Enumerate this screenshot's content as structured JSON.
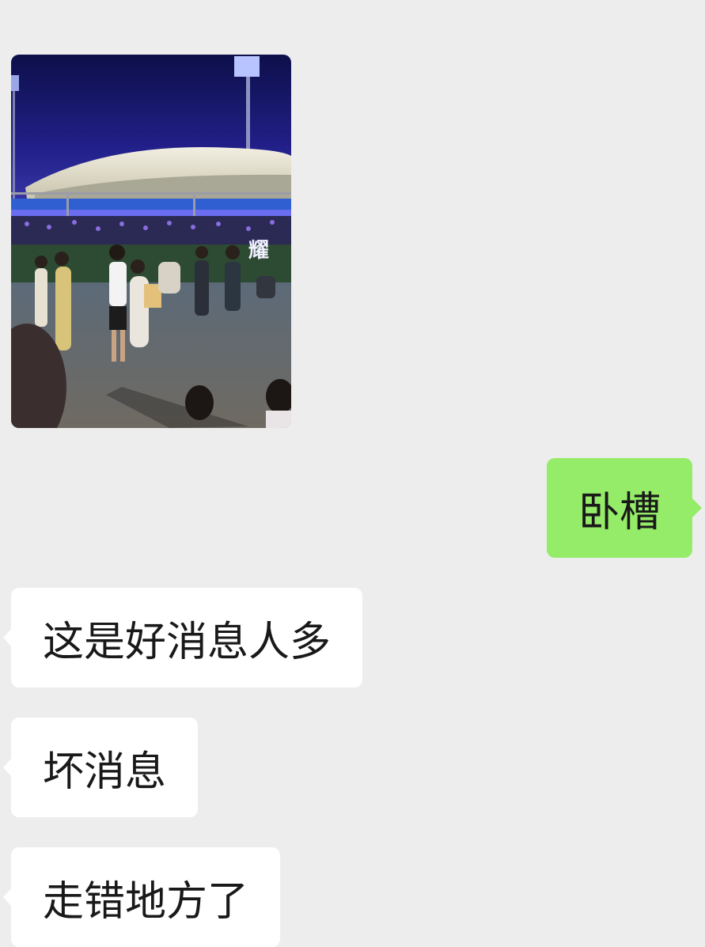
{
  "colors": {
    "background": "#ededed",
    "incoming_bubble": "#ffffff",
    "outgoing_bubble": "#95ec69",
    "text": "#191919"
  },
  "messages": [
    {
      "direction": "incoming",
      "type": "image",
      "icon": "photo-stadium-night-crowd"
    },
    {
      "direction": "outgoing",
      "type": "text",
      "text": "卧槽"
    },
    {
      "direction": "incoming",
      "type": "text",
      "text": "这是好消息人多"
    },
    {
      "direction": "incoming",
      "type": "text",
      "text": "坏消息"
    },
    {
      "direction": "incoming",
      "type": "text",
      "text": "走错地方了"
    }
  ]
}
